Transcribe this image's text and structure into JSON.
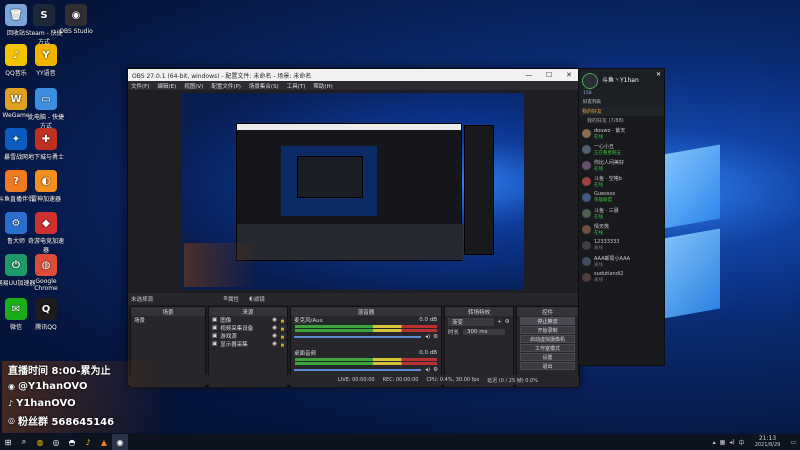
{
  "desktop": {
    "icons": [
      {
        "label": "回收站",
        "glyph": "🗑",
        "color": "#7aa7d8"
      },
      {
        "label": "Steam - 快捷方式",
        "glyph": "S",
        "color": "#1b2838"
      },
      {
        "label": "OBS Studio",
        "glyph": "◉",
        "color": "#302e31"
      },
      {
        "label": "QQ音乐",
        "glyph": "♪",
        "color": "#f5c400"
      },
      {
        "label": "YY语音",
        "glyph": "Y",
        "color": "#f0b400"
      },
      {
        "label": "WeGame",
        "glyph": "W",
        "color": "#e0a020"
      },
      {
        "label": "此电脑 - 快捷方式",
        "glyph": "▭",
        "color": "#3b8fe0"
      },
      {
        "label": "暴雪战网",
        "glyph": "✦",
        "color": "#0a5cc0"
      },
      {
        "label": "地下城与勇士",
        "glyph": "✚",
        "color": "#c03020"
      },
      {
        "label": "斗鱼直播伴侣",
        "glyph": "?",
        "color": "#f07a20"
      },
      {
        "label": "雷神加速器",
        "glyph": "◐",
        "color": "#f09020"
      },
      {
        "label": "鲁大师",
        "glyph": "⚙",
        "color": "#2a6fd0"
      },
      {
        "label": "奇游电竞加速器",
        "glyph": "◆",
        "color": "#d03030"
      },
      {
        "label": "网易UU加速器",
        "glyph": "⏻",
        "color": "#1e9a6a"
      },
      {
        "label": "Google Chrome",
        "glyph": "◍",
        "color": "#dd4b39"
      },
      {
        "label": "微信",
        "glyph": "✉",
        "color": "#1aad19"
      },
      {
        "label": "腾讯QQ",
        "glyph": "Q",
        "color": "#1c1c1c"
      }
    ]
  },
  "obs": {
    "title": "OBS 27.0.1 (64-bit, windows) - 配置文件: 未命名 - 场景: 未命名",
    "menu": [
      "文件(F)",
      "编辑(E)",
      "视图(V)",
      "配置文件(P)",
      "场景集合(S)",
      "工具(T)",
      "帮助(H)"
    ],
    "no_source": "未选择源",
    "properties_label": "属性",
    "filters_label": "滤镜",
    "scenes": {
      "header": "场景",
      "items": [
        "场景"
      ]
    },
    "sources": {
      "header": "来源",
      "items": [
        "图像",
        "视频采集设备",
        "游戏源",
        "显示器采集"
      ]
    },
    "mixer": {
      "header": "混音器",
      "channels": [
        {
          "name": "麦克风/Aux",
          "db": "0.0 dB"
        },
        {
          "name": "桌面音频",
          "db": "0.0 dB"
        }
      ]
    },
    "transitions": {
      "header": "转场特效",
      "type": "渐变",
      "duration_label": "时长",
      "duration_value": "300 ms"
    },
    "controls": {
      "header": "控件",
      "buttons": [
        "停止推流",
        "开始录制",
        "启动虚拟摄像机",
        "工作室模式",
        "设置",
        "退出"
      ]
    },
    "status": [
      "LIVE: 00:00:00",
      "REC: 00:00:00",
      "CPU: 0.4%, 30.00 fps",
      "延迟 (0 / 25 帧) 0.0%"
    ]
  },
  "qq": {
    "name": "斗鱼丶Y1han",
    "level": "158",
    "group_label": "好友列表",
    "tab": "我的好友",
    "section": "我的好友 (7/88)",
    "contacts": [
      {
        "name": "douwo · 紫天",
        "status": "在线",
        "color": "#8a6a50"
      },
      {
        "name": "一心小丑",
        "status": "正在看星期五",
        "color": "#506070"
      },
      {
        "name": "你比人间美好",
        "status": "在线",
        "color": "#6a5070"
      },
      {
        "name": "斗鱼 · 空格b",
        "status": "在线",
        "color": "#a04040"
      },
      {
        "name": "Guessxx",
        "status": "英雄联盟",
        "color": "#405a80"
      },
      {
        "name": "斗鱼 · 三晨",
        "status": "在线",
        "color": "#506050"
      },
      {
        "name": "情天熊",
        "status": "在线",
        "color": "#705040"
      },
      {
        "name": "12333333",
        "status": "离线",
        "color": "#404040"
      },
      {
        "name": "AAA邮局小AAA",
        "status": "离线",
        "color": "#404a60"
      },
      {
        "name": "sudutiandi2",
        "status": "离线",
        "color": "#503a3a"
      }
    ]
  },
  "stream": {
    "lines": [
      "直播时间 8:00-累为止",
      "@Y1hanOVO",
      "Y1hanOVO",
      "粉丝群 568645146"
    ]
  },
  "taskbar": {
    "time": "21:13",
    "date": "2021/8/29"
  }
}
